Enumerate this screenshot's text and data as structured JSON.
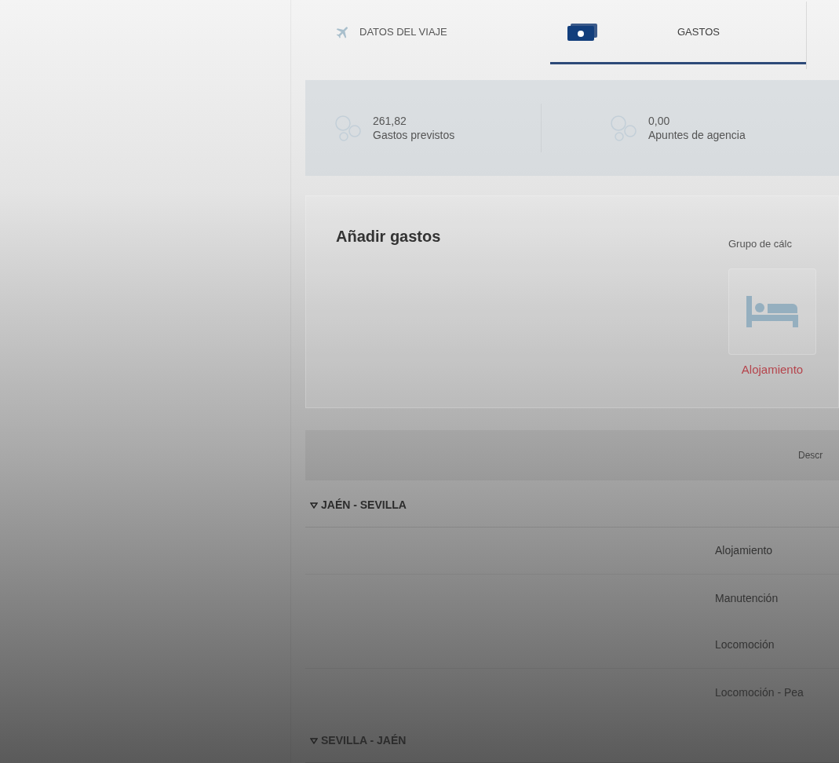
{
  "tabs": [
    {
      "label": "DATOS DEL VIAJE",
      "selected": false
    },
    {
      "label": "GASTOS",
      "selected": true
    }
  ],
  "summary": [
    {
      "amount": "261,82",
      "label": "Gastos previstos"
    },
    {
      "amount": "0,00",
      "label": "Apuntes de agencia"
    }
  ],
  "add_expenses": {
    "title": "Añadir gastos",
    "group_label": "Grupo de cálc",
    "categories": [
      {
        "label": "Alojamiento"
      }
    ]
  },
  "table": {
    "columns": [
      "Descr"
    ],
    "groups": [
      {
        "title": "JAÉN - SEVILLA",
        "expanded": true,
        "rows": [
          "Alojamiento",
          "Manutención",
          "Locomoción",
          "Locomoción - Pea"
        ]
      },
      {
        "title": "SEVILLA - JAÉN",
        "expanded": true
      }
    ]
  }
}
